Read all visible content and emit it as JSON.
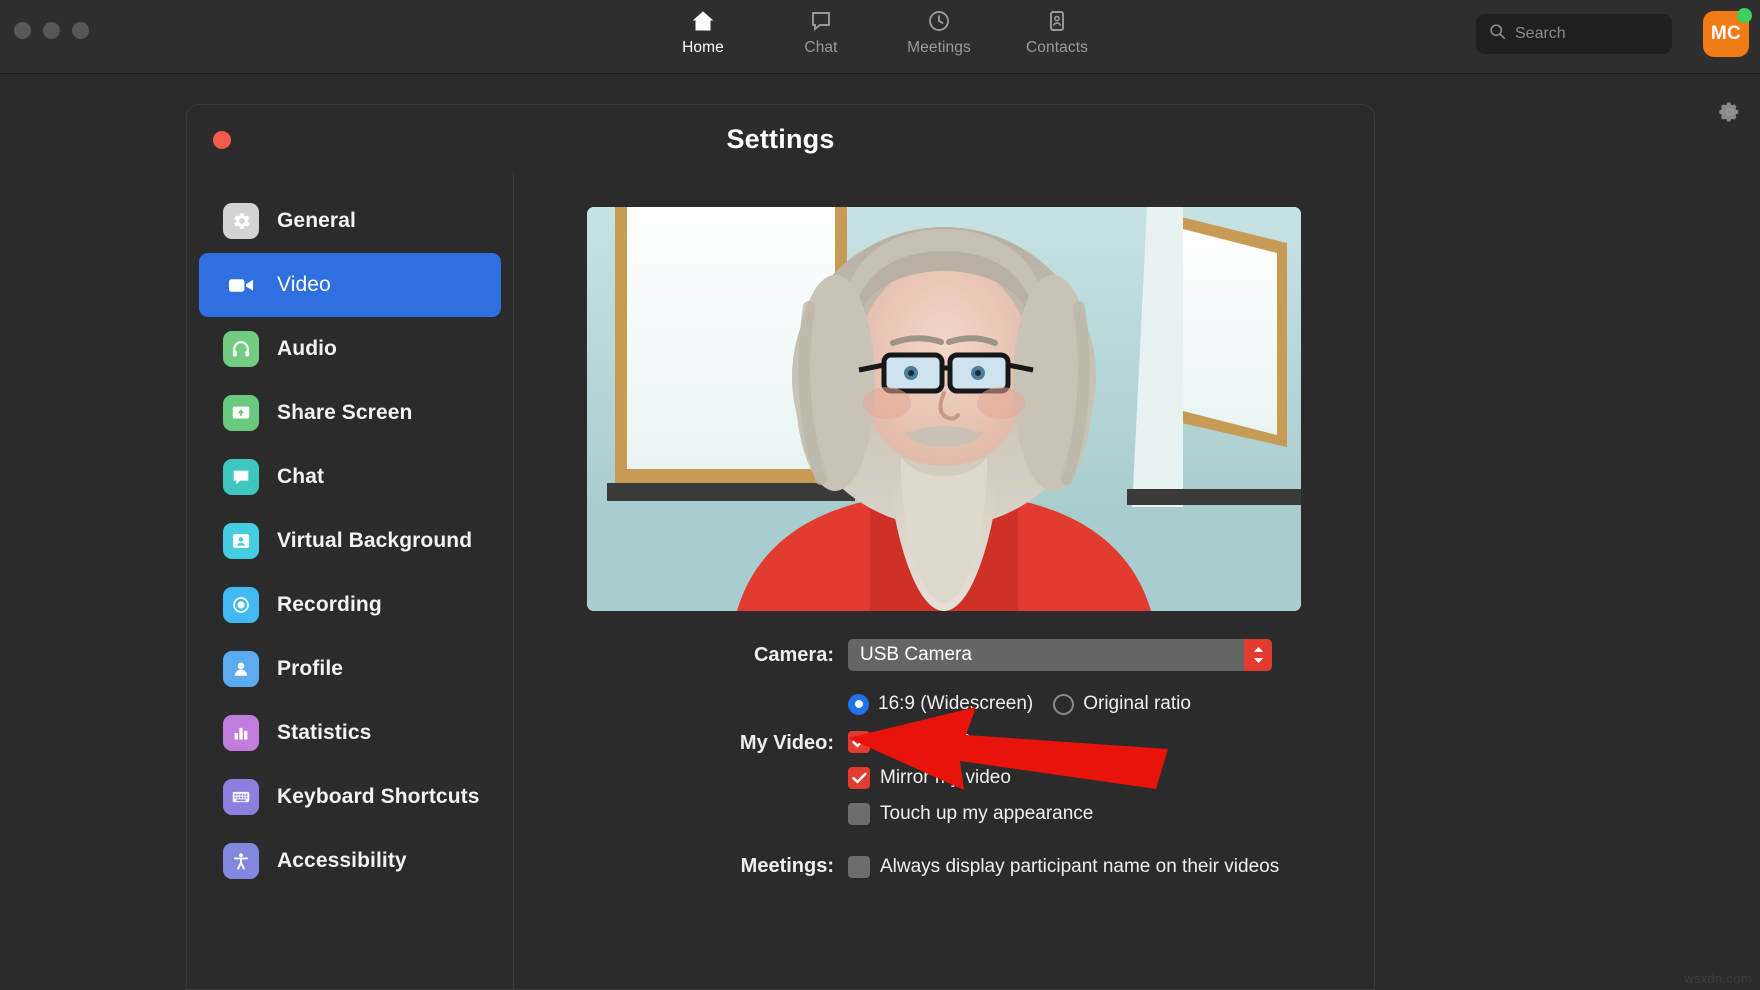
{
  "window": {
    "traffic_lights": [
      "close",
      "minimize",
      "maximize"
    ]
  },
  "topnav": {
    "tabs": [
      {
        "label": "Home",
        "icon": "home-icon",
        "active": true
      },
      {
        "label": "Chat",
        "icon": "chat-bubble-icon",
        "active": false
      },
      {
        "label": "Meetings",
        "icon": "clock-icon",
        "active": false
      },
      {
        "label": "Contacts",
        "icon": "contact-card-icon",
        "active": false
      }
    ],
    "search": {
      "placeholder": "Search",
      "value": "",
      "icon": "search-icon"
    },
    "avatar": {
      "initials": "MC",
      "bg_color": "#f27b16",
      "presence": "available",
      "presence_color": "#3ad15c"
    },
    "gear": {
      "icon": "gear-icon"
    }
  },
  "settings": {
    "title": "Settings",
    "close_label": "Close",
    "sidebar": [
      {
        "label": "General",
        "icon": "gear-icon",
        "color": "#d3d3d3",
        "active": false
      },
      {
        "label": "Video",
        "icon": "video-camera-icon",
        "color": "#2f6fdf",
        "active": true
      },
      {
        "label": "Audio",
        "icon": "headphones-icon",
        "color": "#72cd83",
        "active": false
      },
      {
        "label": "Share Screen",
        "icon": "share-screen-icon",
        "color": "#69c97e",
        "active": false
      },
      {
        "label": "Chat",
        "icon": "chat-bubble-icon",
        "color": "#3ec7bf",
        "active": false
      },
      {
        "label": "Virtual Background",
        "icon": "person-card-icon",
        "color": "#45cde0",
        "active": false
      },
      {
        "label": "Recording",
        "icon": "record-circle-icon",
        "color": "#42b9f0",
        "active": false
      },
      {
        "label": "Profile",
        "icon": "person-icon",
        "color": "#5aabf0",
        "active": false
      },
      {
        "label": "Statistics",
        "icon": "bar-chart-icon",
        "color": "#c07ddb",
        "active": false
      },
      {
        "label": "Keyboard Shortcuts",
        "icon": "keyboard-icon",
        "color": "#8d7fe0",
        "active": false
      },
      {
        "label": "Accessibility",
        "icon": "accessibility-icon",
        "color": "#8188dd",
        "active": false
      }
    ],
    "video_panel": {
      "preview_alt": "camera-preview",
      "camera": {
        "label": "Camera:",
        "value": "USB Camera",
        "stepper_color": "#e23c31"
      },
      "aspect_ratio": {
        "options": [
          {
            "label": "16:9 (Widescreen)",
            "selected": true
          },
          {
            "label": "Original ratio",
            "selected": false
          }
        ]
      },
      "my_video": {
        "label": "My Video:",
        "checkboxes": [
          {
            "label": "Enable HD",
            "checked": true
          },
          {
            "label": "Mirror my video",
            "checked": true
          },
          {
            "label": "Touch up my appearance",
            "checked": false
          }
        ]
      },
      "meetings": {
        "label": "Meetings:",
        "checkboxes": [
          {
            "label": "Always display participant name on their videos",
            "checked": false
          }
        ]
      }
    }
  },
  "annotation": {
    "arrow_color": "#e8140b",
    "points_at": "Enable HD"
  },
  "watermark": {
    "text": "wsxdn.com"
  }
}
